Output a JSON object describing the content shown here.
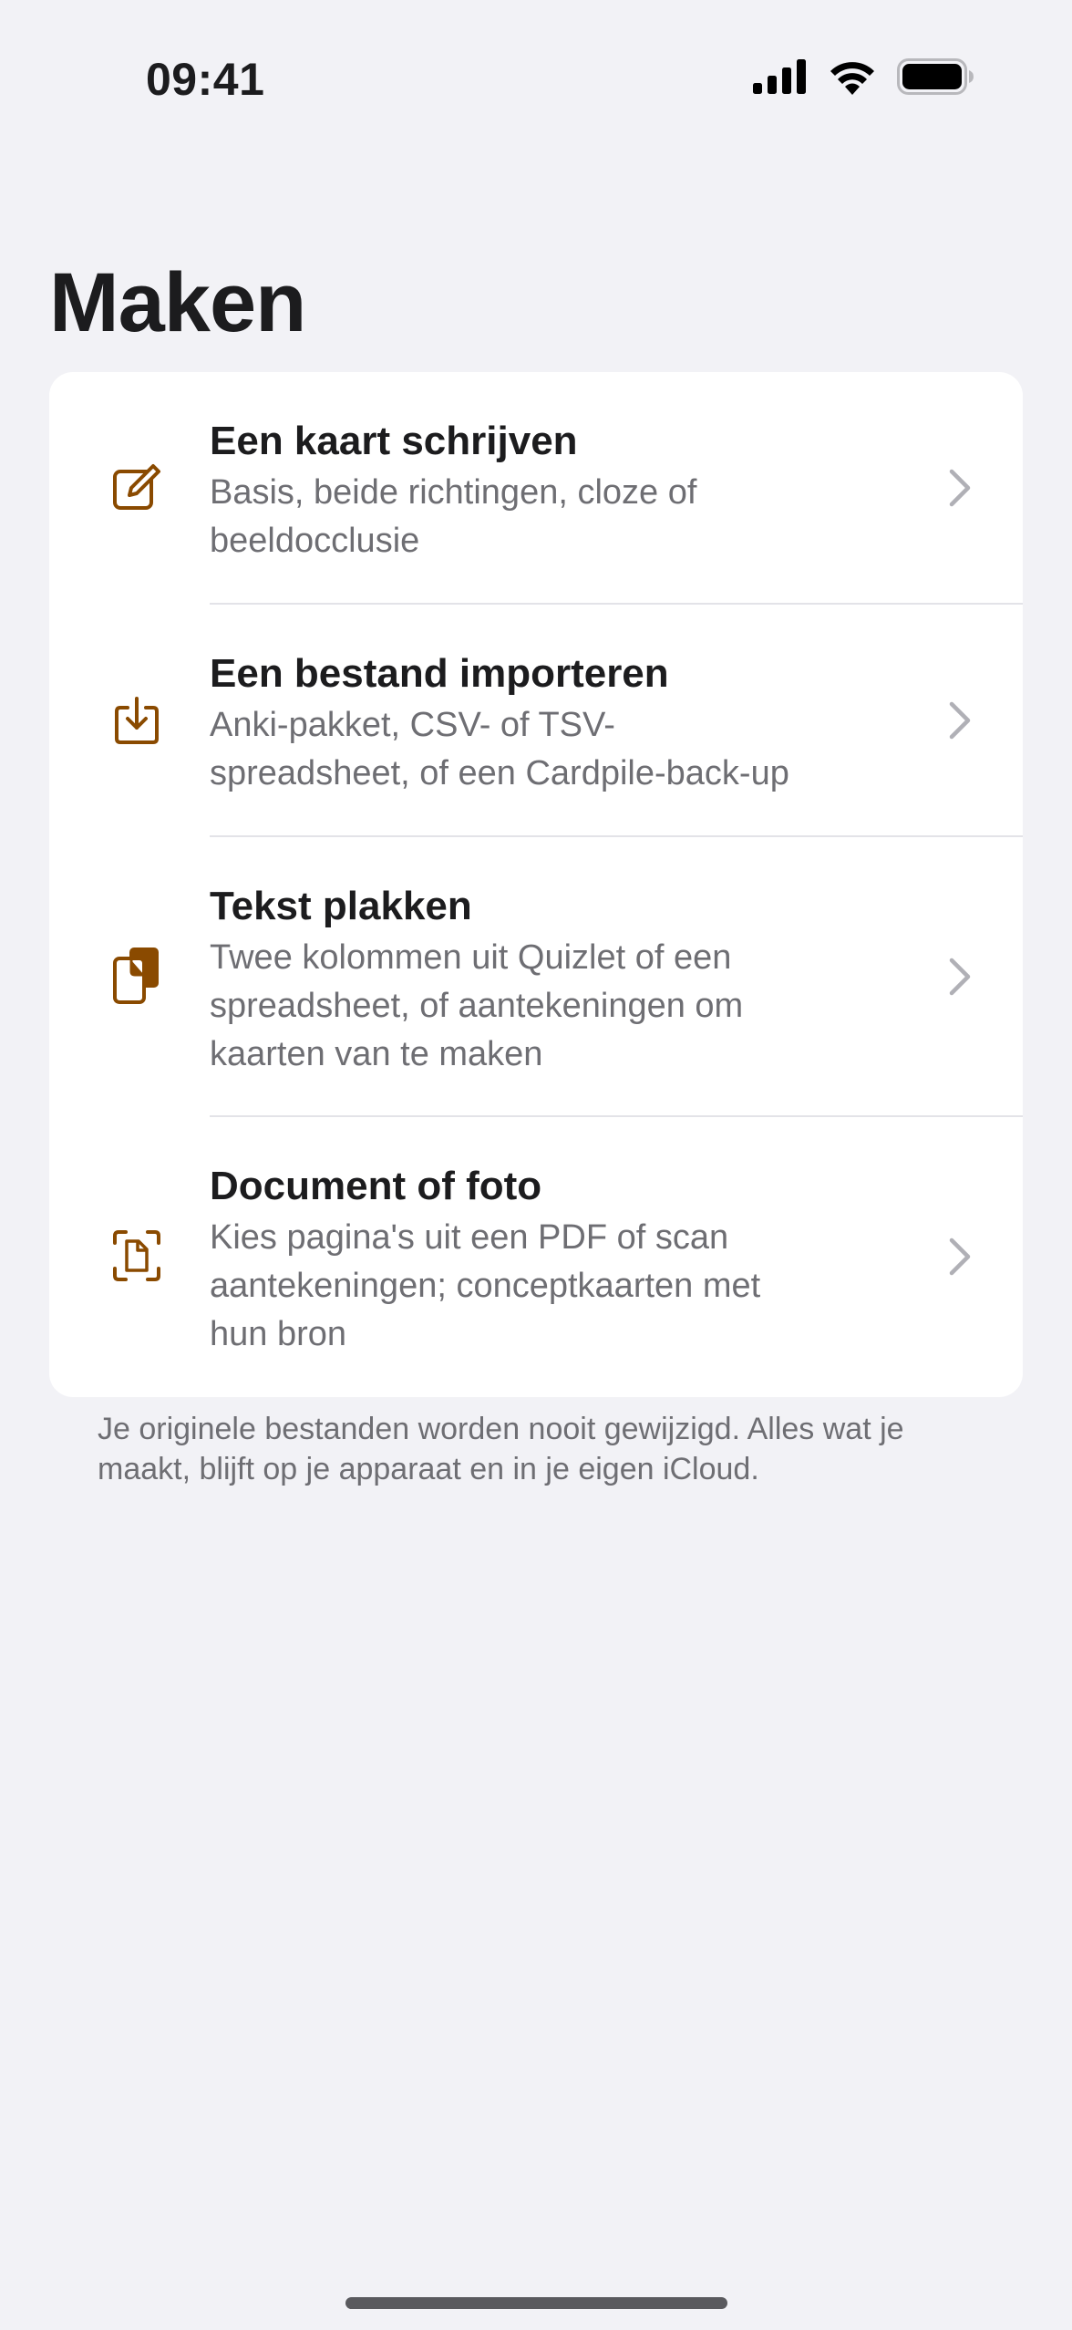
{
  "status_bar": {
    "time": "09:41",
    "icons": [
      "cellular-signal-icon",
      "wifi-icon",
      "battery-icon"
    ]
  },
  "page": {
    "title": "Maken"
  },
  "options": [
    {
      "title": "Een kaart schrijven",
      "subtitle_lines": [
        "Basis, beide richtingen, cloze of",
        "beeldocclusie"
      ],
      "icon": "compose-icon"
    },
    {
      "title": "Een bestand importeren",
      "subtitle_lines": [
        "Anki-pakket, CSV- of TSV-",
        "spreadsheet, of een Cardpile-back-up"
      ],
      "icon": "import-tray-icon"
    },
    {
      "title": "Tekst plakken",
      "subtitle_lines": [
        "Twee kolommen uit Quizlet of een",
        "spreadsheet, of aantekeningen om",
        "kaarten van te maken"
      ],
      "icon": "paste-clipboard-icon"
    },
    {
      "title": "Document of foto",
      "subtitle_lines": [
        "Kies pagina's uit een PDF of scan",
        "aantekeningen; conceptkaarten met",
        "hun bron"
      ],
      "icon": "document-scan-icon"
    }
  ],
  "footnote": {
    "lines": [
      "Je originele bestanden worden nooit gewijzigd. Alles wat je",
      "maakt, blijft op je apparaat en in je eigen iCloud."
    ]
  },
  "colors": {
    "accent": "#8a4a00",
    "background": "#f2f2f6",
    "card": "#ffffff",
    "secondary_text": "#6e6e73",
    "chevron": "#b0b0b6"
  }
}
